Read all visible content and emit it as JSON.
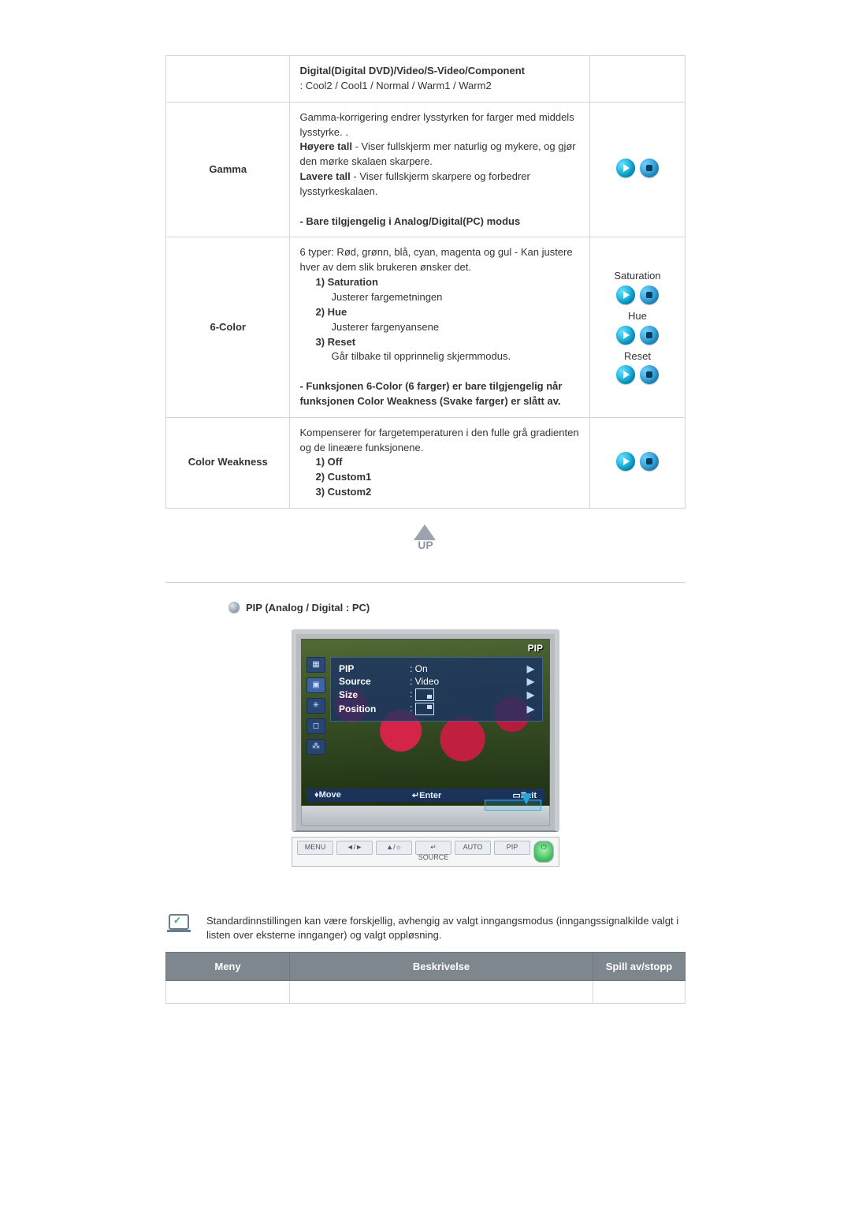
{
  "rows": {
    "digital": {
      "title": "Digital(Digital DVD)/Video/S-Video/Component",
      "sub": ": Cool2 / Cool1 / Normal / Warm1 / Warm2"
    },
    "gamma": {
      "menu": "Gamma",
      "p1": "Gamma-korrigering endrer lysstyrken for farger med middels lysstyrke. .",
      "p2a": "Høyere tall",
      "p2b": " - Viser fullskjerm mer naturlig og mykere, og gjør den mørke skalaen skarpere.",
      "p3a": "Lavere tall",
      "p3b": " - Viser fullskjerm skarpere og forbedrer lysstyrkeskalaen.",
      "note": "- Bare tilgjengelig i Analog/Digital(PC) modus"
    },
    "sixcolor": {
      "menu": "6-Color",
      "intro": "6 typer: Rød, grønn, blå, cyan, magenta og gul - Kan justere hver av dem slik brukeren ønsker det.",
      "i1t": "1) Saturation",
      "i1d": "Justerer fargemetningen",
      "i2t": "2) Hue",
      "i2d": "Justerer fargenyansene",
      "i3t": "3) Reset",
      "i3d": "Går tilbake til opprinnelig skjermmodus.",
      "note": "- Funksjonen 6-Color (6 farger) er bare tilgjengelig når funksjonen Color Weakness (Svake farger) er slått av.",
      "ctrl": {
        "sat": "Saturation",
        "hue": "Hue",
        "reset": "Reset"
      }
    },
    "cw": {
      "menu": "Color Weakness",
      "p": "Kompenserer for fargetemperaturen i den fulle grå gradienten og de lineære funksjonene.",
      "o1": "1) Off",
      "o2": "2) Custom1",
      "o3": "3) Custom2"
    }
  },
  "up_label": "UP",
  "section_title": "PIP (Analog / Digital : PC)",
  "osd": {
    "header": "PIP",
    "items": {
      "pip_k": "PIP",
      "pip_v": ": On",
      "src_k": "Source",
      "src_v": ": Video",
      "size_k": "Size",
      "pos_k": "Position"
    },
    "footer": {
      "move": "♦Move",
      "enter": "↵Enter",
      "exit": "▭Exit"
    }
  },
  "hw_buttons": {
    "menu": "MENU",
    "b2": "◄/►",
    "b3": "▲/☼",
    "b4": "↵",
    "auto": "AUTO",
    "pip": "PIP",
    "pwr": "⏻",
    "source": "SOURCE"
  },
  "note_text": "Standardinnstillingen kan være forskjellig, avhengig av valgt inngangsmodus (inngangssignalkilde valgt i listen over eksterne innganger) og valgt oppløsning.",
  "table2": {
    "h1": "Meny",
    "h2": "Beskrivelse",
    "h3": "Spill av/stopp"
  }
}
